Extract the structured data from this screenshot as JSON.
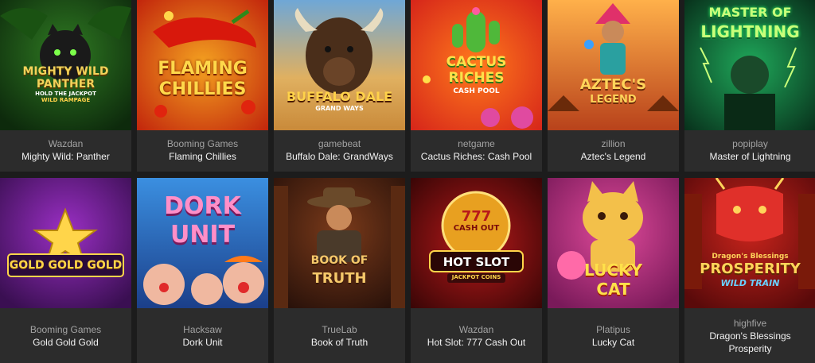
{
  "games": [
    {
      "provider": "Wazdan",
      "title": "Mighty Wild: Panther",
      "art": {
        "line1": "MIGHTY WILD",
        "line2": "PANTHER",
        "line3": "HOLD THE JACKPOT",
        "line4": "WILD RAMPAGE"
      },
      "icon": "panther-icon",
      "colors": {
        "bg1": "#2f7a22",
        "bg2": "#0d2a0c",
        "text": "#f3d25a"
      }
    },
    {
      "provider": "Booming Games",
      "title": "Flaming Chillies",
      "art": {
        "line1": "FLAMING",
        "line2": "CHILLIES"
      },
      "icon": "chilli-icon",
      "colors": {
        "bg1": "#f4a220",
        "bg2": "#c2260c",
        "text": "#ffd84a"
      }
    },
    {
      "provider": "gamebeat",
      "title": "Buffalo Dale: GrandWays",
      "art": {
        "line1": "BUFFALO DALE",
        "line2": "GRAND WAYS"
      },
      "icon": "buffalo-icon",
      "colors": {
        "bg1": "#6fa7d6",
        "bg2": "#c98a3a",
        "text": "#ffd24a"
      }
    },
    {
      "provider": "netgame",
      "title": "Cactus Riches: Cash Pool",
      "art": {
        "line1": "CACTUS",
        "line2": "RICHES",
        "line3": "CASH POOL"
      },
      "icon": "cactus-icon",
      "colors": {
        "bg1": "#ff7a1c",
        "bg2": "#d6261a",
        "text": "#ffe04a"
      }
    },
    {
      "provider": "zillion",
      "title": "Aztec's Legend",
      "art": {
        "line1": "AZTEC'S",
        "line2": "LEGEND"
      },
      "icon": "aztec-queen-icon",
      "colors": {
        "bg1": "#ff9a3c",
        "bg2": "#b8421b",
        "text": "#ffd45a"
      }
    },
    {
      "provider": "popiplay",
      "title": "Master of Lightning",
      "art": {
        "line1": "MASTER OF",
        "line2": "LIGHTNING"
      },
      "icon": "lightning-icon",
      "colors": {
        "bg1": "#1fa85a",
        "bg2": "#08321c",
        "text": "#c9ff7a"
      }
    },
    {
      "provider": "Booming Games",
      "title": "Gold Gold Gold",
      "art": {
        "line1": "GOLD GOLD GOLD"
      },
      "icon": "star-icon",
      "colors": {
        "bg1": "#9a2fc4",
        "bg2": "#3a0f52",
        "text": "#ffd54a"
      }
    },
    {
      "provider": "Hacksaw",
      "title": "Dork Unit",
      "art": {
        "line1": "DORK",
        "line2": "UNIT"
      },
      "icon": "clown-icon",
      "colors": {
        "bg1": "#3b8fe0",
        "bg2": "#1b3f8a",
        "text": "#ff8fc8"
      }
    },
    {
      "provider": "TrueLab",
      "title": "Book of Truth",
      "art": {
        "line1": "BOOK OF",
        "line2": "TRUTH"
      },
      "icon": "explorer-icon",
      "colors": {
        "bg1": "#7a3a1a",
        "bg2": "#2a120a",
        "text": "#f5c86a"
      }
    },
    {
      "provider": "Wazdan",
      "title": "Hot Slot: 777 Cash Out",
      "art": {
        "line1": "777",
        "line2": "CASH OUT",
        "line3": "HOT SLOT",
        "line4": "JACKPOT COINS"
      },
      "icon": "coin-icon",
      "colors": {
        "bg1": "#b8191a",
        "bg2": "#3a0606",
        "text": "#ffd54a"
      }
    },
    {
      "provider": "Platipus",
      "title": "Lucky Cat",
      "art": {
        "line1": "LUCKY",
        "line2": "CAT"
      },
      "icon": "lucky-cat-icon",
      "colors": {
        "bg1": "#e04a9a",
        "bg2": "#7a1a5a",
        "text": "#ffe04a"
      }
    },
    {
      "provider": "highfive",
      "title": "Dragon's Blessings Prosperity",
      "art": {
        "line1": "Dragon's Blessings",
        "line2": "PROSPERITY",
        "line3": "WILD TRAIN"
      },
      "icon": "dragon-icon",
      "colors": {
        "bg1": "#c8241c",
        "bg2": "#5a0a0a",
        "text": "#ffd45a"
      }
    }
  ]
}
